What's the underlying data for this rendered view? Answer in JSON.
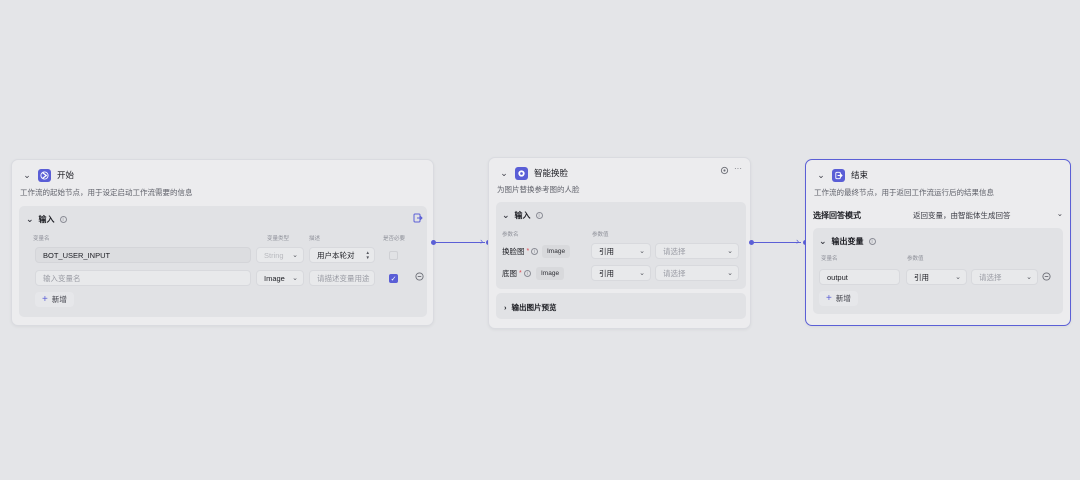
{
  "start_node": {
    "title": "开始",
    "description": "工作流的起始节点，用于设定启动工作流需要的信息",
    "input_section": "输入",
    "columns": {
      "var_name": "变量名",
      "var_type": "变量类型",
      "desc": "描述",
      "required": "是否必要"
    },
    "rows": [
      {
        "name": "BOT_USER_INPUT",
        "type": "String",
        "desc": "用户本轮对"
      },
      {
        "name": "输入变量名",
        "type": "Image",
        "desc": "请描述变量用途"
      }
    ],
    "add_label": "新增"
  },
  "faceswap_node": {
    "title": "智能换脸",
    "description": "为图片替换参考图的人脸",
    "input_section": "输入",
    "columns": {
      "param_name": "参数名",
      "param_value": "参数值"
    },
    "rows": [
      {
        "label": "换脸图",
        "tag": "Image",
        "mode": "引用",
        "placeholder": "请选择"
      },
      {
        "label": "底图",
        "tag": "Image",
        "mode": "引用",
        "placeholder": "请选择"
      }
    ],
    "output_preview": "输出图片预览"
  },
  "end_node": {
    "title": "结束",
    "description": "工作流的最终节点，用于返回工作流运行后的结果信息",
    "mode_label": "选择回答模式",
    "mode_value": "返回变量，由智能体生成回答",
    "output_section": "输出变量",
    "columns": {
      "var_name": "变量名",
      "param_value": "参数值"
    },
    "rows": [
      {
        "name": "output",
        "mode": "引用",
        "placeholder": "请选择"
      }
    ],
    "add_label": "新增"
  },
  "colors": {
    "accent": "#5b5fd6",
    "canvas": "#e4e5e8",
    "node": "#ececee"
  }
}
